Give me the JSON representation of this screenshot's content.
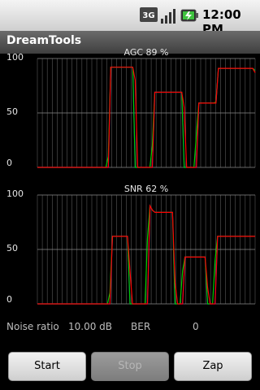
{
  "status_bar": {
    "network_icon": "3g-icon",
    "signal_icon": "signal-strength-icon",
    "battery_icon": "battery-charging-icon",
    "time": "12:00 PM"
  },
  "app": {
    "title": "DreamTools"
  },
  "charts": {
    "agc": {
      "title": "AGC 89 %"
    },
    "snr": {
      "title": "SNR 62 %"
    }
  },
  "chart_data": [
    {
      "type": "line",
      "title": "AGC 89 %",
      "ylim": [
        0,
        100
      ],
      "yticks": [
        "100",
        "50",
        "0"
      ],
      "grid": true,
      "series": [
        {
          "color": "#0000ff",
          "values": [
            0,
            0,
            0,
            0,
            0,
            0,
            0,
            0,
            0,
            0,
            0,
            0,
            0,
            0,
            0,
            0,
            0,
            0,
            0,
            0,
            0,
            0,
            0,
            0,
            0,
            0,
            0,
            0,
            0,
            0,
            92,
            92,
            92,
            92,
            92,
            92,
            92,
            92,
            92,
            92,
            0,
            0,
            0,
            0,
            0,
            0,
            0,
            0,
            69,
            69,
            69,
            69,
            69,
            69,
            69,
            69,
            69,
            69,
            69,
            69,
            0,
            0,
            0,
            0,
            0,
            0,
            59,
            59,
            59,
            59,
            59,
            59,
            59,
            59,
            91,
            91,
            91,
            91,
            91,
            91,
            91,
            91,
            91,
            91,
            91,
            91,
            91,
            91,
            91,
            89
          ]
        },
        {
          "color": "#00cc00",
          "values": [
            0,
            0,
            0,
            0,
            0,
            0,
            0,
            0,
            0,
            0,
            0,
            0,
            0,
            0,
            0,
            0,
            0,
            0,
            0,
            0,
            0,
            0,
            0,
            0,
            0,
            0,
            0,
            0,
            0,
            10,
            92,
            92,
            92,
            92,
            92,
            92,
            92,
            92,
            92,
            92,
            0,
            0,
            0,
            0,
            0,
            0,
            0,
            20,
            69,
            69,
            69,
            69,
            69,
            69,
            69,
            69,
            69,
            69,
            69,
            69,
            0,
            0,
            0,
            0,
            0,
            30,
            59,
            59,
            59,
            59,
            59,
            59,
            59,
            60,
            91,
            91,
            91,
            91,
            91,
            91,
            91,
            91,
            91,
            91,
            91,
            91,
            91,
            91,
            91,
            89
          ]
        },
        {
          "color": "#ff0000",
          "values": [
            0,
            0,
            0,
            0,
            0,
            0,
            0,
            0,
            0,
            0,
            0,
            0,
            0,
            0,
            0,
            0,
            0,
            0,
            0,
            0,
            0,
            0,
            0,
            0,
            0,
            0,
            0,
            0,
            0,
            0,
            92,
            92,
            92,
            92,
            92,
            92,
            92,
            92,
            92,
            92,
            80,
            0,
            0,
            0,
            0,
            0,
            0,
            0,
            69,
            69,
            69,
            69,
            69,
            69,
            69,
            69,
            69,
            69,
            69,
            69,
            55,
            0,
            0,
            0,
            0,
            0,
            59,
            59,
            59,
            59,
            59,
            59,
            59,
            59,
            91,
            91,
            91,
            91,
            91,
            91,
            91,
            91,
            91,
            91,
            91,
            91,
            91,
            91,
            91,
            87
          ]
        }
      ]
    },
    {
      "type": "line",
      "title": "SNR 62 %",
      "ylim": [
        0,
        100
      ],
      "yticks": [
        "100",
        "50",
        "0"
      ],
      "grid": true,
      "series": [
        {
          "color": "#0000ff",
          "values": [
            0,
            0,
            0,
            0,
            0,
            0,
            0,
            0,
            0,
            0,
            0,
            0,
            0,
            0,
            0,
            0,
            0,
            0,
            0,
            0,
            0,
            0,
            0,
            0,
            0,
            0,
            0,
            0,
            0,
            0,
            62,
            62,
            62,
            62,
            62,
            62,
            62,
            0,
            0,
            0,
            0,
            0,
            0,
            0,
            0,
            90,
            86,
            84,
            84,
            84,
            84,
            84,
            84,
            84,
            84,
            0,
            0,
            0,
            0,
            43,
            43,
            43,
            43,
            43,
            43,
            43,
            43,
            43,
            0,
            0,
            0,
            0,
            62,
            62,
            62,
            62,
            62,
            62,
            62,
            62,
            62,
            62,
            62,
            62,
            62,
            62,
            62,
            62
          ]
        },
        {
          "color": "#00cc00",
          "values": [
            0,
            0,
            0,
            0,
            0,
            0,
            0,
            0,
            0,
            0,
            0,
            0,
            0,
            0,
            0,
            0,
            0,
            0,
            0,
            0,
            0,
            0,
            0,
            0,
            0,
            0,
            0,
            0,
            0,
            10,
            62,
            62,
            62,
            62,
            62,
            62,
            62,
            0,
            0,
            0,
            0,
            0,
            0,
            0,
            60,
            90,
            86,
            84,
            84,
            84,
            84,
            84,
            84,
            84,
            84,
            0,
            0,
            0,
            30,
            43,
            43,
            43,
            43,
            43,
            43,
            43,
            43,
            43,
            0,
            0,
            0,
            40,
            62,
            62,
            62,
            62,
            62,
            62,
            62,
            62,
            62,
            62,
            62,
            62,
            62,
            62,
            62,
            62
          ]
        },
        {
          "color": "#ff0000",
          "values": [
            0,
            0,
            0,
            0,
            0,
            0,
            0,
            0,
            0,
            0,
            0,
            0,
            0,
            0,
            0,
            0,
            0,
            0,
            0,
            0,
            0,
            0,
            0,
            0,
            0,
            0,
            0,
            0,
            0,
            0,
            62,
            62,
            62,
            62,
            62,
            62,
            62,
            30,
            0,
            0,
            0,
            0,
            0,
            0,
            0,
            90,
            86,
            84,
            84,
            84,
            84,
            84,
            84,
            84,
            84,
            20,
            0,
            0,
            0,
            43,
            43,
            43,
            43,
            43,
            43,
            43,
            43,
            43,
            15,
            0,
            0,
            0,
            62,
            62,
            62,
            62,
            62,
            62,
            62,
            62,
            62,
            62,
            62,
            62,
            62,
            62,
            62,
            62
          ]
        }
      ]
    }
  ],
  "info": {
    "noise_label": "Noise ratio",
    "noise_value": "10.00 dB",
    "ber_label": "BER",
    "ber_value": "0"
  },
  "buttons": {
    "start": "Start",
    "stop": "Stop",
    "zap": "Zap"
  }
}
